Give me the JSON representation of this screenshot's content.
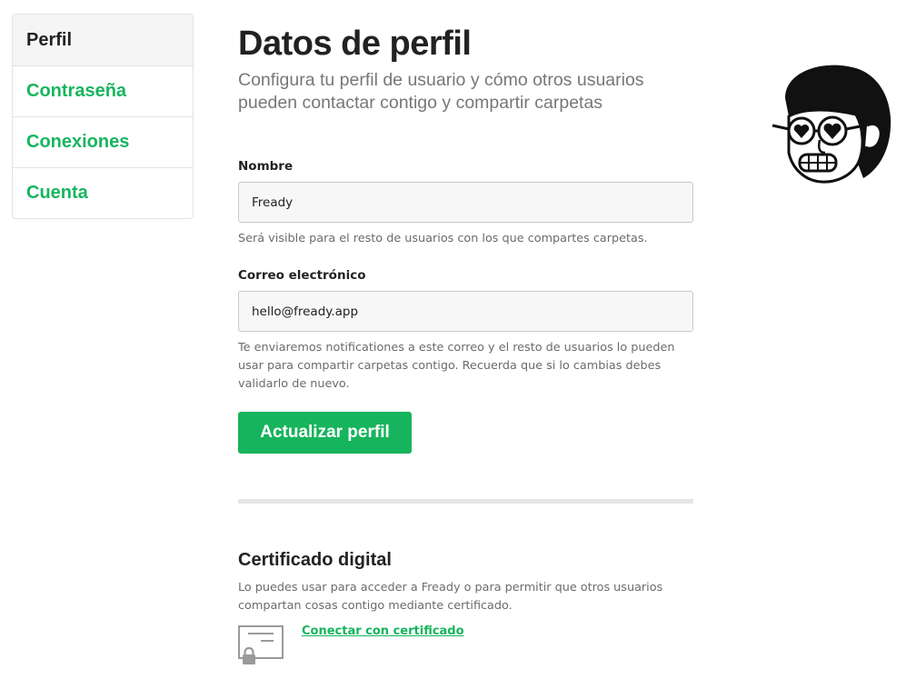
{
  "sidebar": {
    "items": [
      {
        "label": "Perfil",
        "active": true
      },
      {
        "label": "Contraseña"
      },
      {
        "label": "Conexiones"
      },
      {
        "label": "Cuenta"
      }
    ]
  },
  "header": {
    "title": "Datos de perfil",
    "subtitle": "Configura tu perfil de usuario y cómo otros usuarios pueden contactar contigo y compartir carpetas"
  },
  "form": {
    "name": {
      "label": "Nombre",
      "value": "Fready",
      "help": "Será visible para el resto de usuarios con los que compartes carpetas."
    },
    "email": {
      "label": "Correo electrónico",
      "value": "hello@fready.app",
      "help": "Te enviaremos notificationes a este correo y el resto de usuarios lo pueden usar para compartir carpetas contigo. Recuerda que si lo cambias debes validarlo de nuevo."
    },
    "submit_label": "Actualizar perfil"
  },
  "certificate": {
    "title": "Certificado digital",
    "description": "Lo puedes usar para acceder a Fready o para permitir que otros usuarios compartan cosas contigo mediante certificado.",
    "link_label": "Conectar con certificado",
    "icon": "certificate-lock-icon"
  },
  "avatar": {
    "icon": "avatar-illustration"
  },
  "colors": {
    "accent": "#16b45c",
    "text": "#222222",
    "muted": "#777777"
  }
}
